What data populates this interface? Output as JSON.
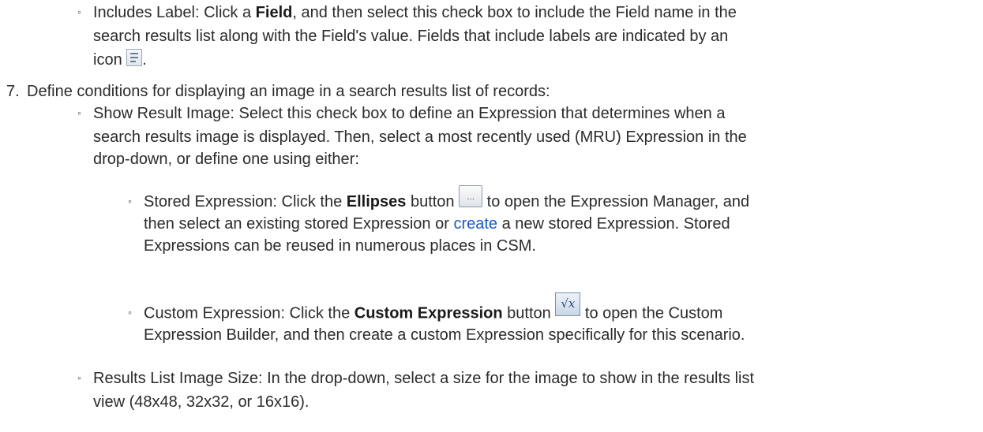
{
  "doc": {
    "includes_label": {
      "line1_a": "Includes Label: Click a ",
      "line1_bold": "Field",
      "line1_b": ", and then select this check box to include the Field name in the",
      "line2": "search results list along with the Field's value. Fields that include labels are indicated by an",
      "line3": "icon",
      "line3_end": "."
    },
    "step7": {
      "number": "7.",
      "text": "Define conditions for displaying an image in a search results list of records:"
    },
    "show_result_image": {
      "line1": "Show Result Image: Select this check box to define an Expression that determines when a",
      "line2": "search results image is displayed. Then, select a most recently used (MRU) Expression in the",
      "line3": "drop-down, or define one using either:"
    },
    "stored_expression": {
      "line1_a": "Stored Expression: Click the ",
      "line1_bold": "Ellipses",
      "line1_b": " button",
      "line1_c": " to open the Expression Manager, and",
      "line2_a": "then select an existing stored Expression or ",
      "line2_link": "create",
      "line2_b": " a new stored Expression. Stored",
      "line3": "Expressions can be reused in numerous places in CSM."
    },
    "custom_expression": {
      "line1_a": "Custom Expression: Click the ",
      "line1_bold": "Custom Expression",
      "line1_b": " button",
      "line1_c": " to open the Custom",
      "line2": "Expression Builder, and then create a custom Expression specifically for this scenario."
    },
    "results_list_image_size": {
      "line1": "Results List Image Size: In the drop-down, select a size for the image to show in the results list",
      "line2": "view (48x48, 32x32, or 16x16)."
    },
    "bullet_glyph": "◦",
    "icons": {
      "label_icon": "label-field-icon",
      "ellipsis_icon": "ellipsis-button-icon",
      "ellipsis_glyph": "...",
      "expression_icon": "custom-expression-icon",
      "expression_glyph": "√x"
    }
  }
}
